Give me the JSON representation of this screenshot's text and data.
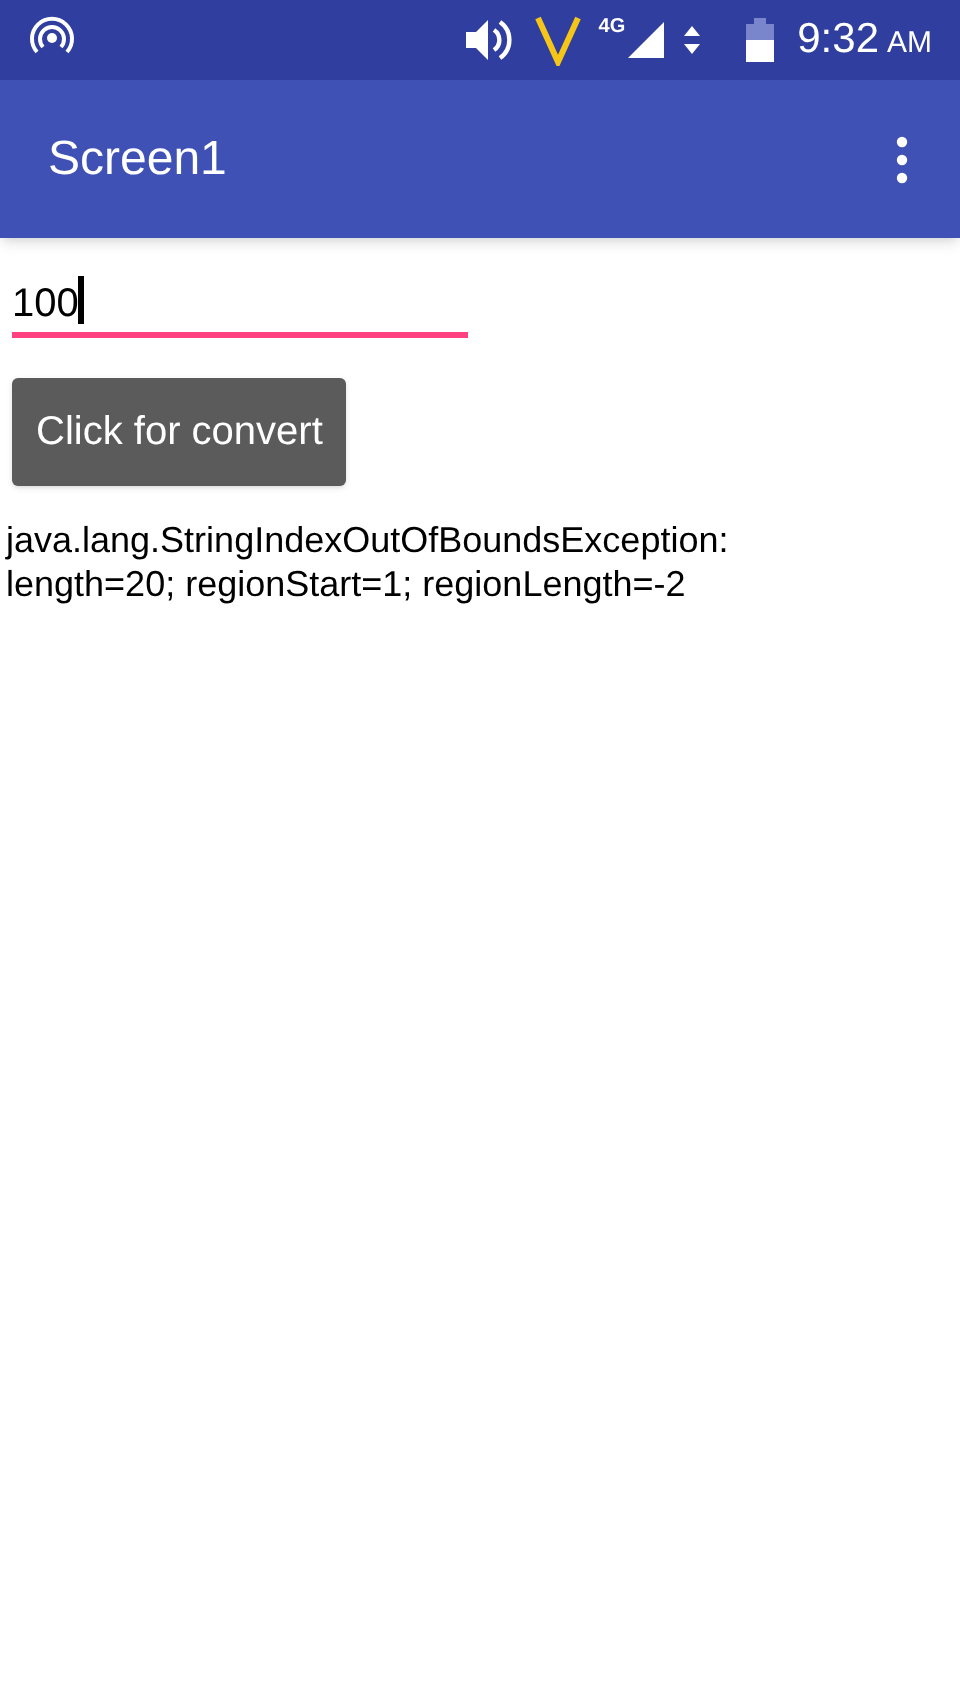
{
  "status_bar": {
    "network": "4G",
    "time": "9:32",
    "meridiem": "AM"
  },
  "app_bar": {
    "title": "Screen1"
  },
  "input": {
    "value": "100",
    "focused": true
  },
  "button": {
    "label": "Click for convert"
  },
  "output": {
    "lines": [
      "java.lang.StringIndexOutOfBoundsException:",
      "length=20; regionStart=1; regionLength=-2"
    ]
  }
}
